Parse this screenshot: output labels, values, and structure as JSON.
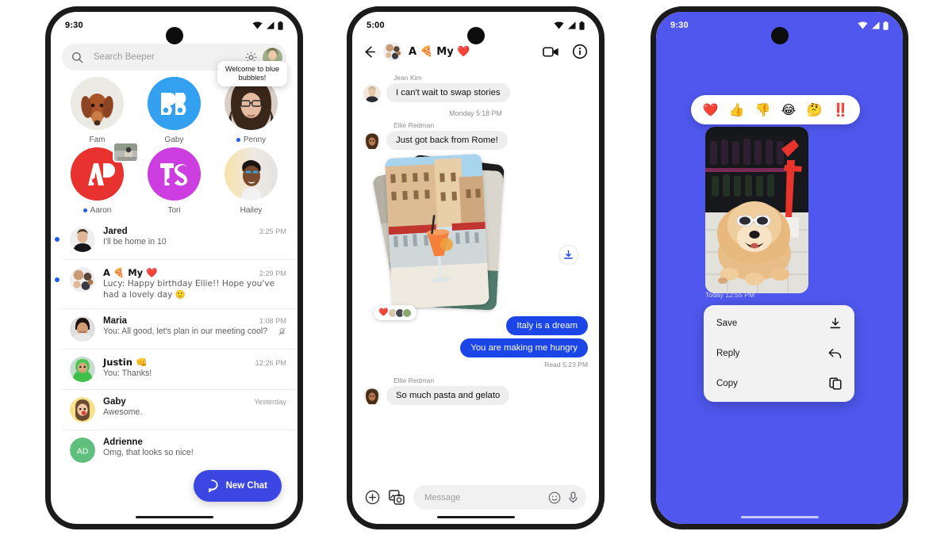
{
  "accent": {
    "purple_bg": "#4F57EE",
    "fab_blue": "#3B46E3",
    "bubble_blue": "#1B45E6",
    "unread_dot": "#1E5BF0"
  },
  "phone1": {
    "statusbar": {
      "time": "9:30",
      "wifi_icon": "wifi-icon",
      "signal_icon": "signal-icon",
      "battery_icon": "battery-icon"
    },
    "search": {
      "placeholder": "Search Beeper",
      "value": "",
      "search_icon": "search-icon",
      "settings_icon": "gear-icon",
      "avatar": "profile-avatar"
    },
    "stories": [
      {
        "name": "Fam",
        "unread": false,
        "tooltip": "",
        "badge": false
      },
      {
        "name": "Gaby",
        "unread": false,
        "tooltip": "",
        "badge": false,
        "initials": "GB"
      },
      {
        "name": "Penny",
        "unread": true,
        "tooltip": "Welcome to blue bubbles!",
        "badge": false
      },
      {
        "name": "Aaron",
        "unread": true,
        "tooltip": "",
        "badge": true,
        "initials": "AN"
      },
      {
        "name": "Tori",
        "unread": false,
        "tooltip": "",
        "badge": false,
        "initials": "TS"
      },
      {
        "name": "Hailey",
        "unread": false,
        "tooltip": "",
        "badge": false
      }
    ],
    "chats": [
      {
        "name": "Jared",
        "time": "3:25 PM",
        "preview": "I'll be home in 10",
        "unread": true,
        "muted": false
      },
      {
        "name": "A 🍕 My ❤️",
        "time": "2:29 PM",
        "preview": "Lucy: Happy birthday Ellie!! Hope you've had a lovely day  🙂",
        "unread": true,
        "muted": false
      },
      {
        "name": "Maria",
        "time": "1:08 PM",
        "preview": "You: All good, let's plan in our meeting cool?",
        "unread": false,
        "muted": true
      },
      {
        "name": "Justin 👊",
        "time": "12:26 PM",
        "preview": "You: Thanks!",
        "unread": false,
        "muted": false
      },
      {
        "name": "Gaby",
        "time": "Yesterday",
        "preview": "Awesome.",
        "unread": false,
        "muted": false
      },
      {
        "name": "Adrienne",
        "time": "",
        "preview": "Omg, that looks so nice!",
        "unread": false,
        "muted": false,
        "initials": "AD"
      }
    ],
    "fab": {
      "label": "New Chat",
      "icon": "chat-bubble-icon"
    }
  },
  "phone2": {
    "statusbar": {
      "time": "5:00"
    },
    "header": {
      "back_icon": "back-arrow-icon",
      "title": "A 🍕 My ❤️",
      "video_icon": "video-camera-icon",
      "info_icon": "info-icon"
    },
    "messages": [
      {
        "type": "incoming",
        "sender": "Jean Kim",
        "text": "I can't wait to swap stories"
      },
      {
        "type": "daystamp",
        "text": "Monday 5:18 PM"
      },
      {
        "type": "incoming",
        "sender": "Ellie Redman",
        "text": "Just got back from Rome!"
      },
      {
        "type": "photostack",
        "reaction": "❤️",
        "reaction_faces": 3,
        "download_icon": "download-icon"
      },
      {
        "type": "outgoing",
        "text": "Italy is a dream"
      },
      {
        "type": "outgoing",
        "text": "You are making me hungry"
      },
      {
        "type": "readmark",
        "text": "Read  5:23 PM"
      },
      {
        "type": "incoming",
        "sender": "Ellie Redman",
        "text": "So much pasta and gelato"
      }
    ],
    "composer": {
      "plus_icon": "plus-circle-icon",
      "gallery_icon": "photo-gallery-icon",
      "placeholder": "Message",
      "value": "",
      "emoji_icon": "emoji-smile-icon",
      "mic_icon": "microphone-icon"
    }
  },
  "phone3": {
    "statusbar": {
      "time": "9:30"
    },
    "reactions": [
      "❤️",
      "👍",
      "👎",
      "😂",
      "🤔",
      "‼️"
    ],
    "photo_timestamp": "Today  12:55 PM",
    "context_menu": [
      {
        "label": "Save",
        "icon": "download-icon"
      },
      {
        "label": "Reply",
        "icon": "reply-arrow-icon"
      },
      {
        "label": "Copy",
        "icon": "copy-icon"
      }
    ]
  }
}
